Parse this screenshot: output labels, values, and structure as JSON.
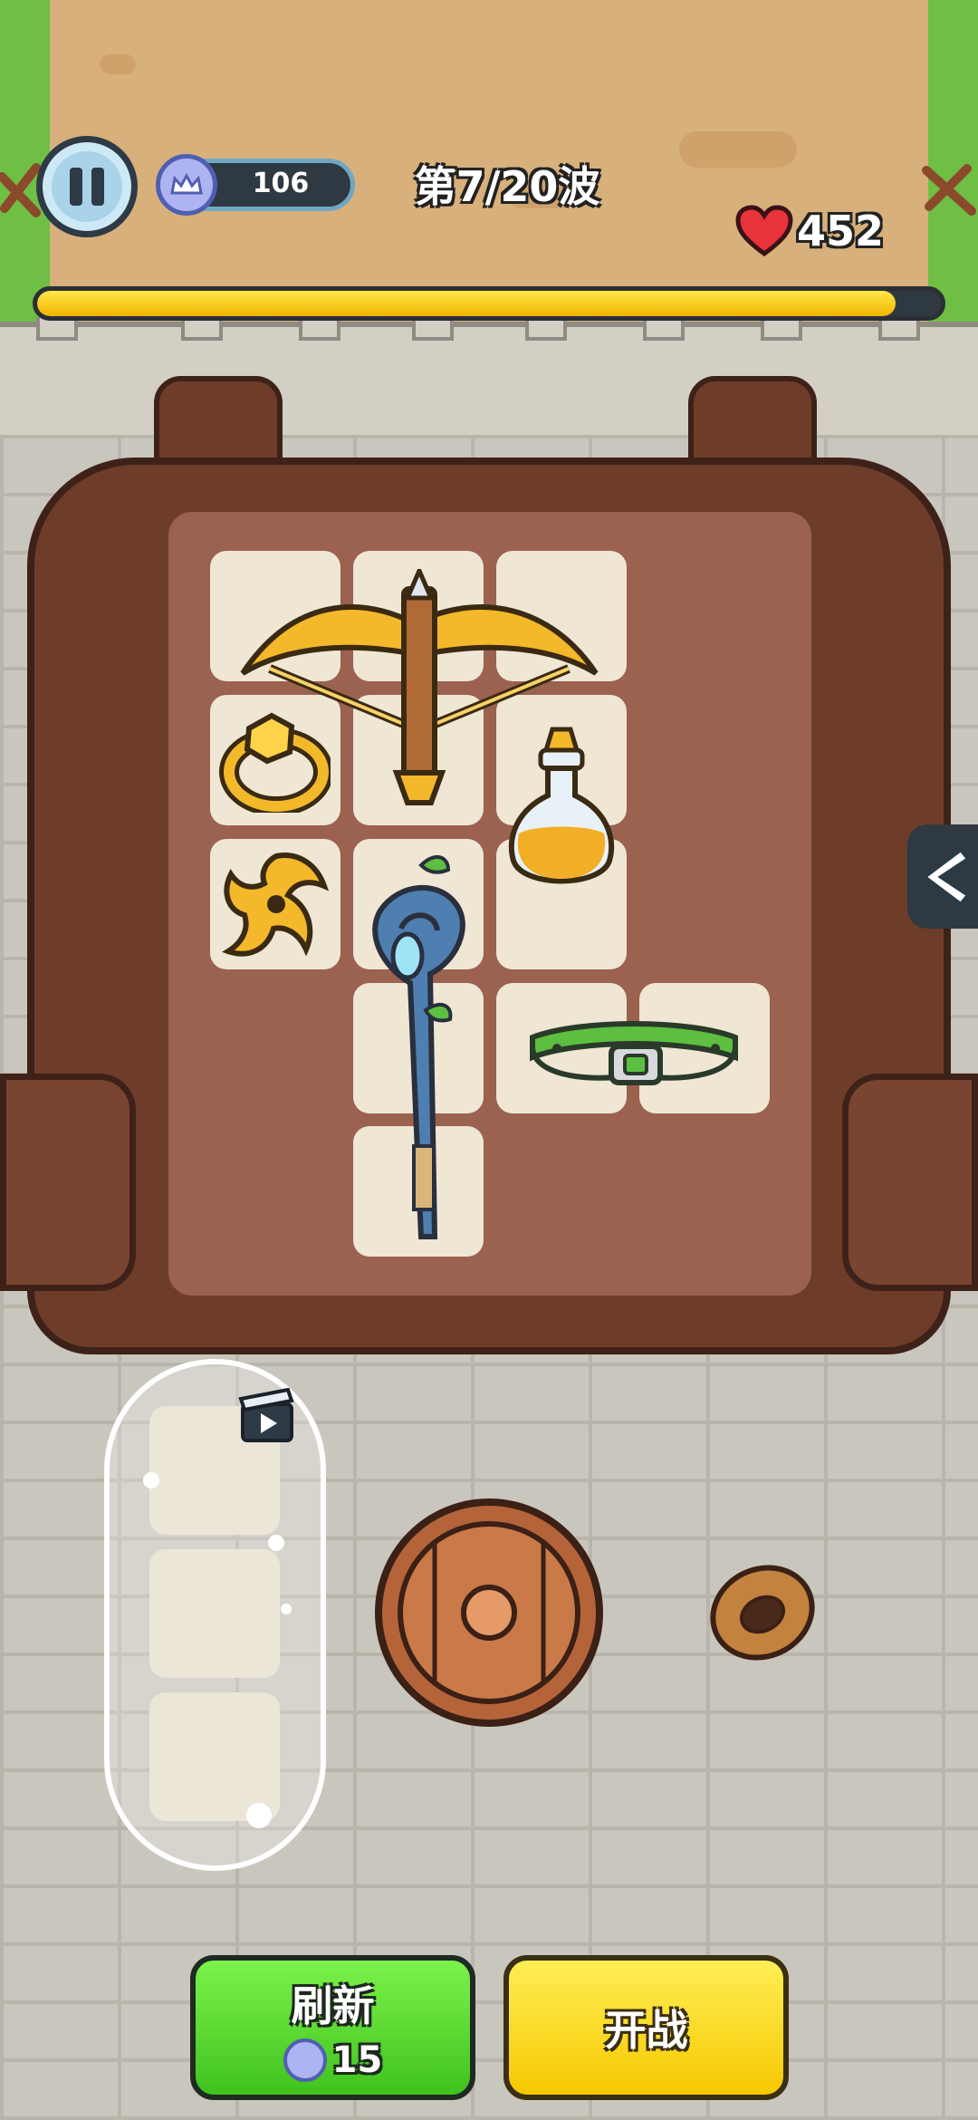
{
  "hud": {
    "coins": "106",
    "wave": "第7/20波",
    "hp": "452",
    "wave_progress": 0.95
  },
  "buttons": {
    "refresh_label": "刷新",
    "refresh_cost": "15",
    "start_label": "开战"
  },
  "icons": {
    "pause": "pause-icon",
    "coin": "crown-coin-icon",
    "heart": "heart-icon",
    "expand": "chevron-left-icon",
    "ad": "video-ad-icon"
  },
  "backpack_items": [
    "crossbow",
    "gold-ring",
    "potion",
    "shuriken",
    "magic-staff",
    "green-belt"
  ],
  "ground_items": [
    "wooden-shield",
    "wooden-ring"
  ],
  "colors": {
    "refresh_button": "#4fd226",
    "start_button": "#f9d91d",
    "progress_fill": "#f7c600",
    "bag": "#6e3d2a"
  }
}
